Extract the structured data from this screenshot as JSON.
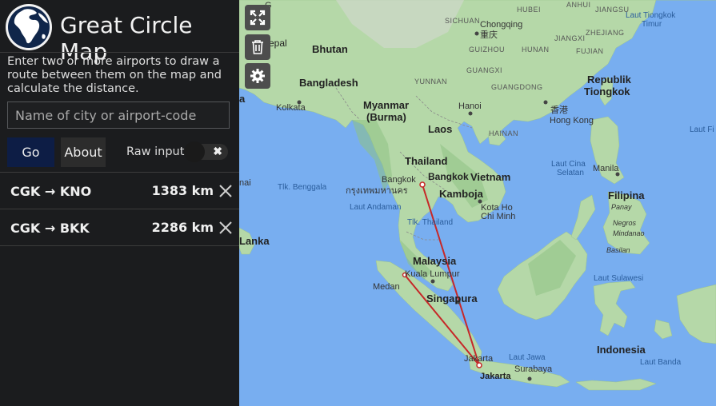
{
  "app": {
    "title": "Great Circle Map"
  },
  "description": "Enter two or more airports to draw a route between them on the map and calculate the distance.",
  "search": {
    "placeholder": "Name of city or airport-code"
  },
  "buttons": {
    "go": "Go",
    "about": "About"
  },
  "raw_input": {
    "label": "Raw input",
    "enabled": false
  },
  "routes": [
    {
      "name": "CGK → KNO",
      "distance": "1383 km"
    },
    {
      "name": "CGK → BKK",
      "distance": "2286 km"
    }
  ],
  "map_controls": [
    "expand-icon",
    "trash-icon",
    "gear-icon"
  ],
  "colors": {
    "sidebar_bg": "#1b1c1e",
    "go_button": "#0d1d45",
    "route_line": "#c62828",
    "water": "#78aef0",
    "land": "#a9d19d"
  },
  "map_labels": {
    "nepal": "epal",
    "bhutan": "Bhutan",
    "sichuan": "SICHUAN",
    "hubei": "HUBEI",
    "anhui": "ANHUI",
    "jiangsu": "JIANGSU",
    "chongqing": "Chongqing",
    "chongqing_cn": "重庆",
    "hunan": "HUNAN",
    "jiangxi": "JIANGXI",
    "zhejiang": "ZHEJIANG",
    "guizhou": "GUIZHOU",
    "fujian": "FUJIAN",
    "laut_tiongkok_timur_1": "Laut Tiongkok",
    "laut_tiongkok_timur_2": "Timur",
    "bangladesh": "Bangladesh",
    "yunnan": "YUNNAN",
    "guangxi": "GUANGXI",
    "guangdong": "GUANGDONG",
    "republik_tiongkok_1": "Republik",
    "republik_tiongkok_2": "Tiongkok",
    "kolkata": "Kolkata",
    "myanmar_1": "Myanmar",
    "myanmar_2": "(Burma)",
    "hanoi": "Hanoi",
    "hong_kong_cn": "香港",
    "hong_kong": "Hong Kong",
    "hainan": "HAINAN",
    "laos": "Laos",
    "laut_fi": "Laut Fi",
    "thailand": "Thailand",
    "laut_cina_selatan_1": "Laut Cina",
    "laut_cina_selatan_2": "Selatan",
    "manila": "Manila",
    "bangkok": "Bangkok",
    "bangkok_bold": "Bangkok",
    "bangkok_thai": "กรุงเทพมหานคร",
    "vietnam": "Vietnam",
    "tlk_benggala": "Tlk. Benggala",
    "kamboja": "Kamboja",
    "filipina": "Filipina",
    "panay": "Panay",
    "laut_andaman": "Laut Andaman",
    "kota_ho_chi_minh_1": "Kota Ho",
    "kota_ho_chi_minh_2": "Chi Minh",
    "negros": "Negros",
    "tlk_thailand": "Tlk. Thailand",
    "mindanao": "Mindanao",
    "lanka": "Lanka",
    "malaysia": "Malaysia",
    "basilan": "Basilan",
    "kuala_lumpur": "Kuala Lumpur",
    "laut_sulawesi": "Laut Sulawesi",
    "medan": "Medan",
    "singapura": "Singapura",
    "jakarta": "Jakarta",
    "jakarta_bold": "Jakarta",
    "laut_jawa": "Laut Jawa",
    "indonesia": "Indonesia",
    "laut_banda": "Laut Banda",
    "surabaya": "Surabaya",
    "nai": "nai",
    "a": "a",
    "g": "G"
  }
}
